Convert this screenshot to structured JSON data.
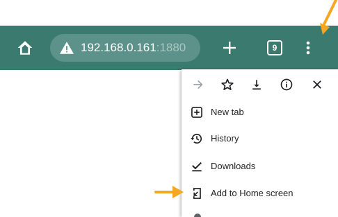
{
  "toolbar": {
    "url_host": "192.168.0.161",
    "url_port": ":1880",
    "tab_count": "9",
    "background_color": "#3b7b6f",
    "omnibox_color": "#5c928a",
    "icons": [
      "home-icon",
      "warning-icon",
      "plus-icon",
      "tab-switcher-icon",
      "more-vert-icon"
    ]
  },
  "menu": {
    "top_icons": [
      "forward-icon",
      "star-icon",
      "download-icon",
      "info-icon",
      "close-icon"
    ],
    "items": [
      {
        "label": "New tab",
        "icon": "new-tab-icon"
      },
      {
        "label": "History",
        "icon": "history-icon"
      },
      {
        "label": "Downloads",
        "icon": "downloads-icon"
      },
      {
        "label": "Add to Home screen",
        "icon": "add-to-home-icon"
      }
    ]
  },
  "annotations": {
    "arrow_color": "#f5a623"
  }
}
